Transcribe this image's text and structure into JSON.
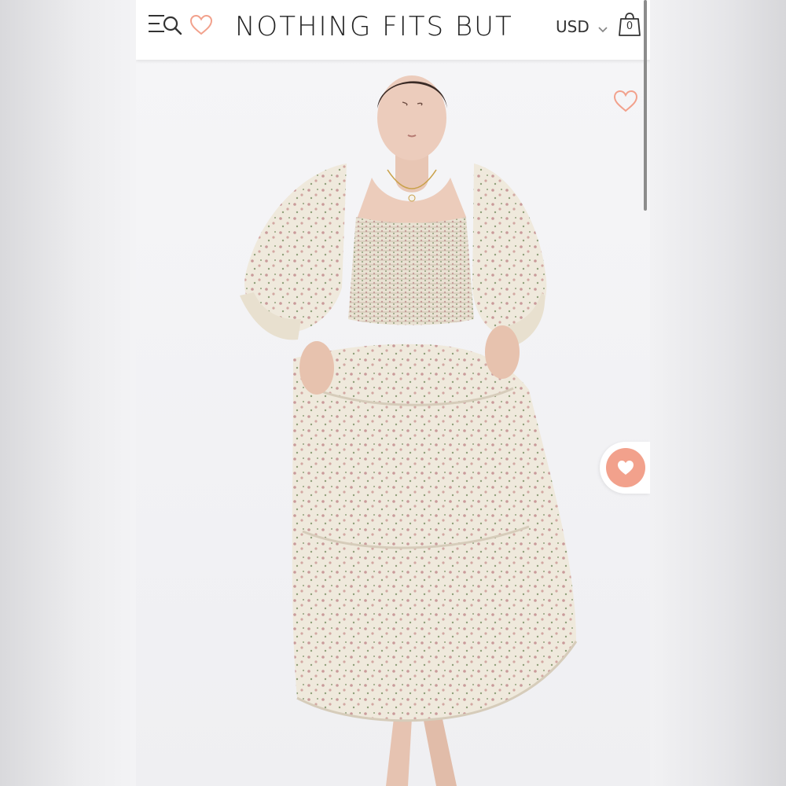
{
  "header": {
    "brand": "NOTHING FITS BUT",
    "currency": "USD",
    "cart_count": "0",
    "menu_icon": "menu-search-icon",
    "wishlist_icon": "heart-outline-icon",
    "currency_icon": "chevron-down-icon",
    "cart_icon": "shopping-bag-icon"
  },
  "product_image": {
    "subject": "model in floral smocked tiered puff-sleeve maxi dress",
    "wishlist_icon": "heart-outline-icon"
  },
  "floating_wishlist": {
    "icon": "heart-filled-icon"
  },
  "colors": {
    "accent": "#f2a18c",
    "header_bg": "#ffffff",
    "text": "#222222"
  }
}
